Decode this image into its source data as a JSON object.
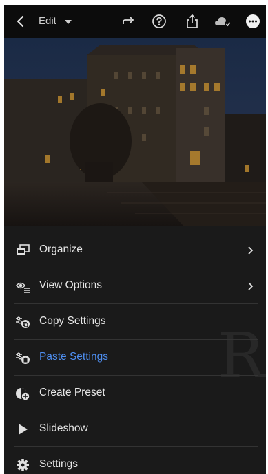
{
  "topbar": {
    "edit_label": "Edit",
    "icons": [
      "back-icon",
      "caret-down-icon",
      "redo-icon",
      "help-icon",
      "share-icon",
      "cloud-sync-icon",
      "more-icon"
    ]
  },
  "menu": {
    "items": [
      {
        "label": "Organize",
        "icon": "organize-icon",
        "chevron": true,
        "active": false
      },
      {
        "label": "View Options",
        "icon": "view-options-icon",
        "chevron": true,
        "active": false
      },
      {
        "label": "Copy Settings",
        "icon": "copy-settings-icon",
        "chevron": false,
        "active": false
      },
      {
        "label": "Paste Settings",
        "icon": "paste-settings-icon",
        "chevron": false,
        "active": true
      },
      {
        "label": "Create Preset",
        "icon": "create-preset-icon",
        "chevron": false,
        "active": false
      },
      {
        "label": "Slideshow",
        "icon": "play-icon",
        "chevron": false,
        "active": false
      },
      {
        "label": "Settings",
        "icon": "gear-icon",
        "chevron": false,
        "active": false
      }
    ]
  },
  "colors": {
    "accent": "#4e8ff2",
    "menu_bg": "#1a1a1a",
    "topbar_bg": "#0c0c0c"
  }
}
